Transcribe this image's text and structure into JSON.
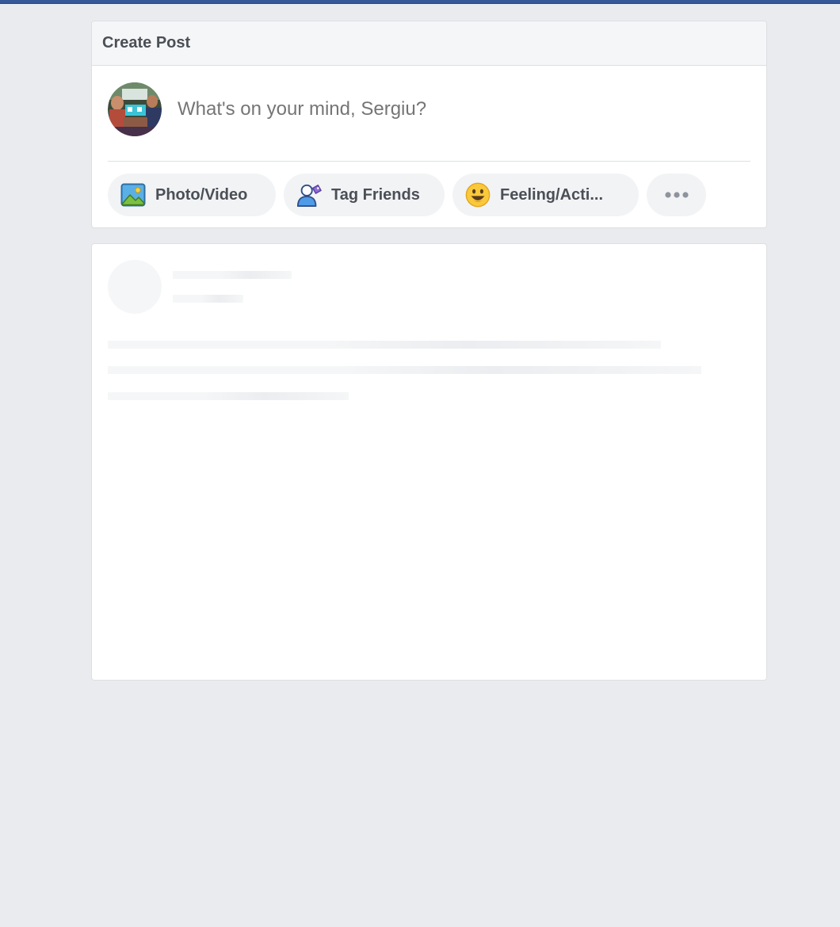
{
  "composer": {
    "title": "Create Post",
    "placeholder": "What's on your mind, Sergiu?",
    "avatar_alt": "profile photo",
    "actions": [
      {
        "label": "Photo/Video",
        "icon": "photo-icon"
      },
      {
        "label": "Tag Friends",
        "icon": "tag-friends-icon"
      },
      {
        "label": "Feeling/Acti...",
        "icon": "smiley-icon"
      },
      {
        "label": "",
        "icon": "more-icon"
      }
    ]
  },
  "feed": {
    "state": "loading"
  },
  "colors": {
    "brand_bar": "#365899",
    "page_background": "#e9ebee",
    "card_border": "#dddfe2",
    "muted_text": "#8d949e",
    "label_text": "#4b4f56"
  }
}
